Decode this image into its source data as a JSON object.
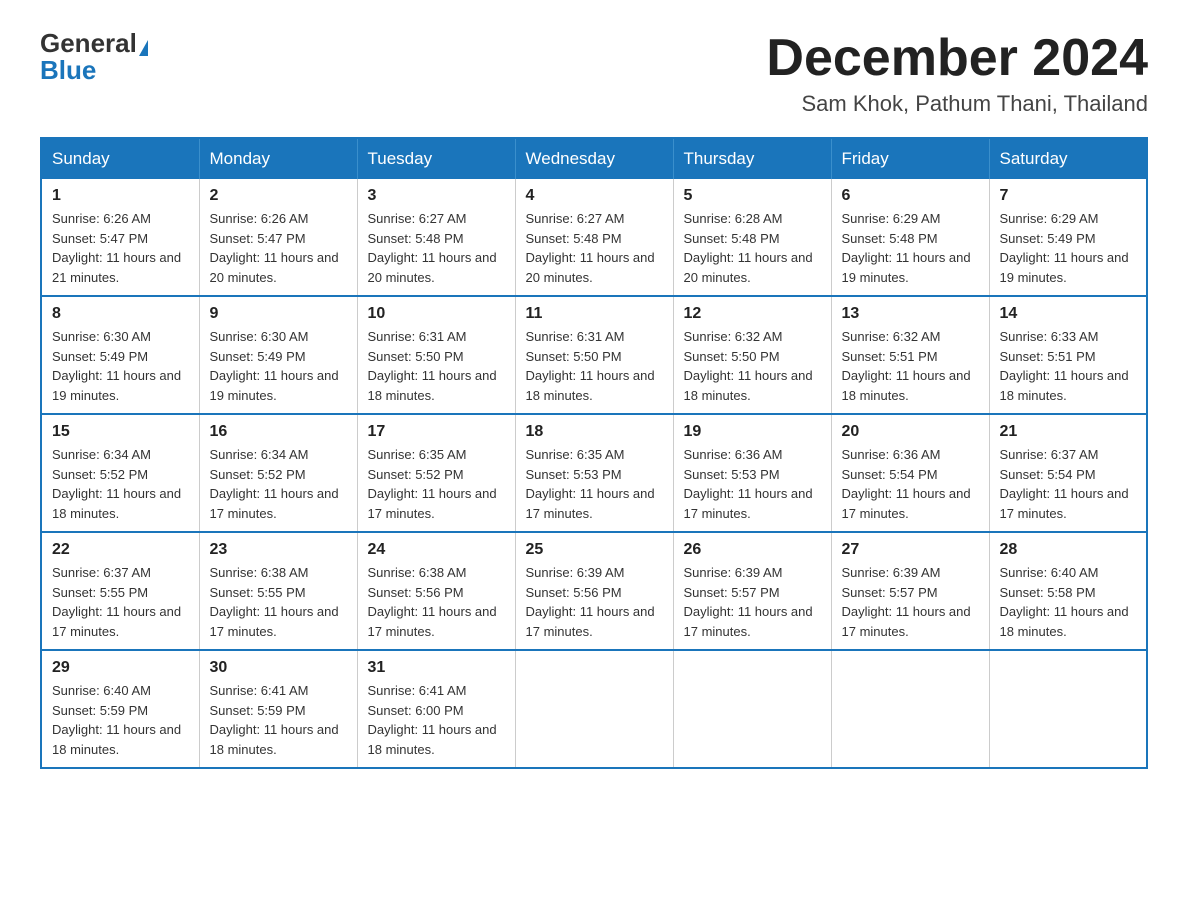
{
  "header": {
    "logo_general": "General",
    "logo_blue": "Blue",
    "month_title": "December 2024",
    "location": "Sam Khok, Pathum Thani, Thailand"
  },
  "days_of_week": [
    "Sunday",
    "Monday",
    "Tuesday",
    "Wednesday",
    "Thursday",
    "Friday",
    "Saturday"
  ],
  "weeks": [
    [
      {
        "day": "1",
        "sunrise": "6:26 AM",
        "sunset": "5:47 PM",
        "daylight": "11 hours and 21 minutes."
      },
      {
        "day": "2",
        "sunrise": "6:26 AM",
        "sunset": "5:47 PM",
        "daylight": "11 hours and 20 minutes."
      },
      {
        "day": "3",
        "sunrise": "6:27 AM",
        "sunset": "5:48 PM",
        "daylight": "11 hours and 20 minutes."
      },
      {
        "day": "4",
        "sunrise": "6:27 AM",
        "sunset": "5:48 PM",
        "daylight": "11 hours and 20 minutes."
      },
      {
        "day": "5",
        "sunrise": "6:28 AM",
        "sunset": "5:48 PM",
        "daylight": "11 hours and 20 minutes."
      },
      {
        "day": "6",
        "sunrise": "6:29 AM",
        "sunset": "5:48 PM",
        "daylight": "11 hours and 19 minutes."
      },
      {
        "day": "7",
        "sunrise": "6:29 AM",
        "sunset": "5:49 PM",
        "daylight": "11 hours and 19 minutes."
      }
    ],
    [
      {
        "day": "8",
        "sunrise": "6:30 AM",
        "sunset": "5:49 PM",
        "daylight": "11 hours and 19 minutes."
      },
      {
        "day": "9",
        "sunrise": "6:30 AM",
        "sunset": "5:49 PM",
        "daylight": "11 hours and 19 minutes."
      },
      {
        "day": "10",
        "sunrise": "6:31 AM",
        "sunset": "5:50 PM",
        "daylight": "11 hours and 18 minutes."
      },
      {
        "day": "11",
        "sunrise": "6:31 AM",
        "sunset": "5:50 PM",
        "daylight": "11 hours and 18 minutes."
      },
      {
        "day": "12",
        "sunrise": "6:32 AM",
        "sunset": "5:50 PM",
        "daylight": "11 hours and 18 minutes."
      },
      {
        "day": "13",
        "sunrise": "6:32 AM",
        "sunset": "5:51 PM",
        "daylight": "11 hours and 18 minutes."
      },
      {
        "day": "14",
        "sunrise": "6:33 AM",
        "sunset": "5:51 PM",
        "daylight": "11 hours and 18 minutes."
      }
    ],
    [
      {
        "day": "15",
        "sunrise": "6:34 AM",
        "sunset": "5:52 PM",
        "daylight": "11 hours and 18 minutes."
      },
      {
        "day": "16",
        "sunrise": "6:34 AM",
        "sunset": "5:52 PM",
        "daylight": "11 hours and 17 minutes."
      },
      {
        "day": "17",
        "sunrise": "6:35 AM",
        "sunset": "5:52 PM",
        "daylight": "11 hours and 17 minutes."
      },
      {
        "day": "18",
        "sunrise": "6:35 AM",
        "sunset": "5:53 PM",
        "daylight": "11 hours and 17 minutes."
      },
      {
        "day": "19",
        "sunrise": "6:36 AM",
        "sunset": "5:53 PM",
        "daylight": "11 hours and 17 minutes."
      },
      {
        "day": "20",
        "sunrise": "6:36 AM",
        "sunset": "5:54 PM",
        "daylight": "11 hours and 17 minutes."
      },
      {
        "day": "21",
        "sunrise": "6:37 AM",
        "sunset": "5:54 PM",
        "daylight": "11 hours and 17 minutes."
      }
    ],
    [
      {
        "day": "22",
        "sunrise": "6:37 AM",
        "sunset": "5:55 PM",
        "daylight": "11 hours and 17 minutes."
      },
      {
        "day": "23",
        "sunrise": "6:38 AM",
        "sunset": "5:55 PM",
        "daylight": "11 hours and 17 minutes."
      },
      {
        "day": "24",
        "sunrise": "6:38 AM",
        "sunset": "5:56 PM",
        "daylight": "11 hours and 17 minutes."
      },
      {
        "day": "25",
        "sunrise": "6:39 AM",
        "sunset": "5:56 PM",
        "daylight": "11 hours and 17 minutes."
      },
      {
        "day": "26",
        "sunrise": "6:39 AM",
        "sunset": "5:57 PM",
        "daylight": "11 hours and 17 minutes."
      },
      {
        "day": "27",
        "sunrise": "6:39 AM",
        "sunset": "5:57 PM",
        "daylight": "11 hours and 17 minutes."
      },
      {
        "day": "28",
        "sunrise": "6:40 AM",
        "sunset": "5:58 PM",
        "daylight": "11 hours and 18 minutes."
      }
    ],
    [
      {
        "day": "29",
        "sunrise": "6:40 AM",
        "sunset": "5:59 PM",
        "daylight": "11 hours and 18 minutes."
      },
      {
        "day": "30",
        "sunrise": "6:41 AM",
        "sunset": "5:59 PM",
        "daylight": "11 hours and 18 minutes."
      },
      {
        "day": "31",
        "sunrise": "6:41 AM",
        "sunset": "6:00 PM",
        "daylight": "11 hours and 18 minutes."
      },
      null,
      null,
      null,
      null
    ]
  ]
}
